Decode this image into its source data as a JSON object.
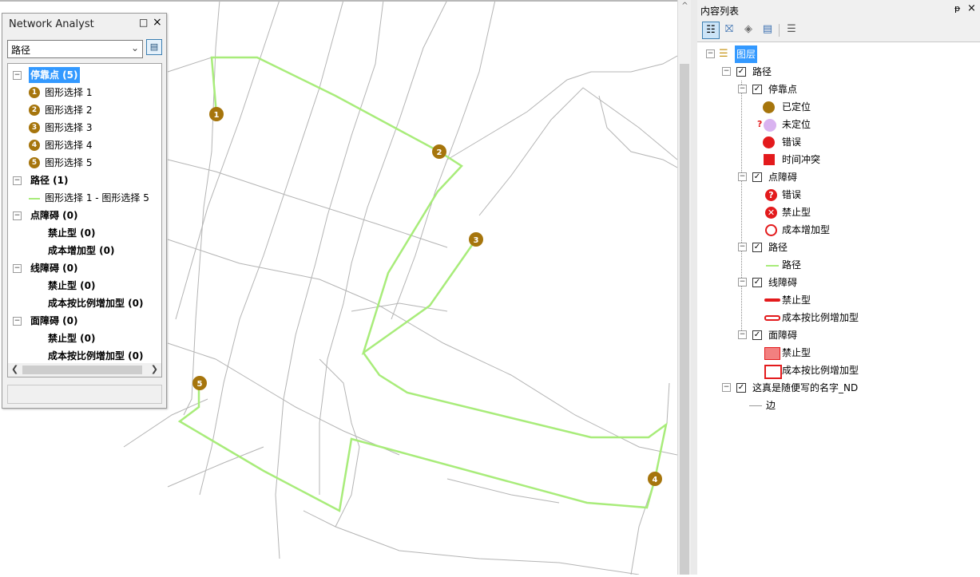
{
  "network_analyst": {
    "title": "Network Analyst",
    "min_glyph": "□",
    "close_glyph": "×",
    "selected_layer": "路径",
    "stops_header": "停靠点 (5)",
    "stops": [
      {
        "num": "1",
        "label": "图形选择 1"
      },
      {
        "num": "2",
        "label": "图形选择 2"
      },
      {
        "num": "3",
        "label": "图形选择 3"
      },
      {
        "num": "4",
        "label": "图形选择 4"
      },
      {
        "num": "5",
        "label": "图形选择 5"
      }
    ],
    "routes_header": "路径 (1)",
    "route_item": "图形选择 1 - 图形选择 5",
    "point_barriers_header": "点障碍 (0)",
    "point_barriers": [
      "禁止型 (0)",
      "成本增加型 (0)"
    ],
    "line_barriers_header": "线障碍 (0)",
    "line_barriers": [
      "禁止型 (0)",
      "成本按比例增加型 (0)"
    ],
    "polygon_barriers_header": "面障碍 (0)",
    "polygon_barriers": [
      "禁止型 (0)",
      "成本按比例增加型 (0)"
    ]
  },
  "toc": {
    "title": "内容列表",
    "pin_glyph": "ᵽ",
    "close_glyph": "×",
    "root": "图层",
    "group": "路径",
    "stops_layer": "停靠点",
    "stops_legend": [
      "已定位",
      "未定位",
      "错误",
      "时间冲突"
    ],
    "point_barriers_layer": "点障碍",
    "point_barriers_legend": [
      "错误",
      "禁止型",
      "成本增加型"
    ],
    "routes_layer": "路径",
    "routes_legend": "路径",
    "line_barriers_layer": "线障碍",
    "line_barriers_legend": [
      "禁止型",
      "成本按比例增加型"
    ],
    "polygon_barriers_layer": "面障碍",
    "polygon_barriers_legend": [
      "禁止型",
      "成本按比例增加型"
    ],
    "network_layer": "这真是随便写的名字_ND",
    "network_legend": "边"
  },
  "map_stops": [
    {
      "label": "1"
    },
    {
      "label": "2"
    },
    {
      "label": "3"
    },
    {
      "label": "4"
    },
    {
      "label": "5"
    }
  ],
  "colors": {
    "route": "#a8ec7a",
    "stop": "#a6750c",
    "street": "#b4b4b4",
    "error": "#e31a1c",
    "unlocated": "#d9b3f0",
    "selection": "#3399ff"
  }
}
